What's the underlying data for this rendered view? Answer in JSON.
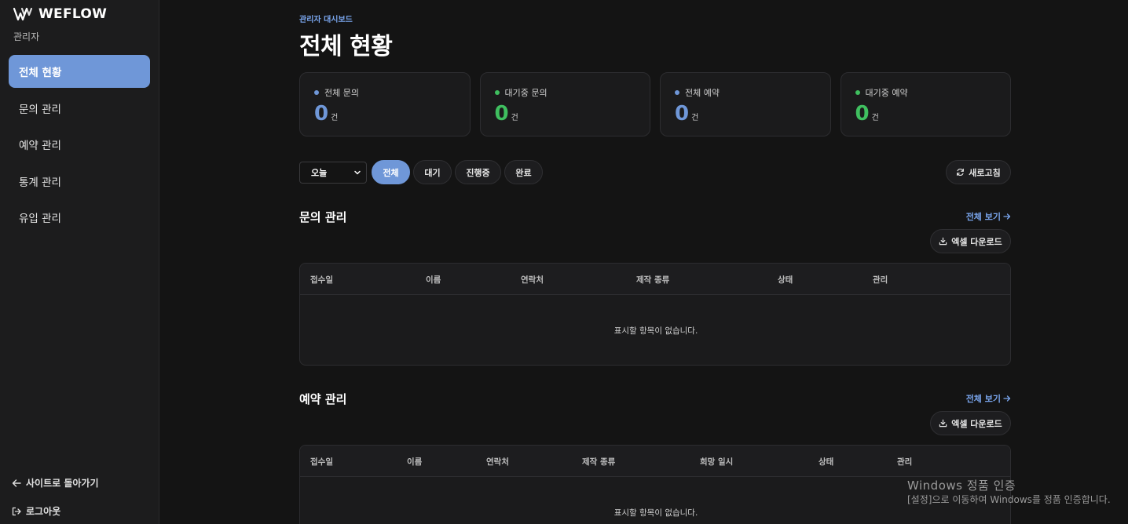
{
  "brand": {
    "name": "WEFLOW",
    "role": "관리자"
  },
  "sidebar": {
    "items": [
      {
        "label": "전체 현황",
        "active": true
      },
      {
        "label": "문의 관리",
        "active": false
      },
      {
        "label": "예약 관리",
        "active": false
      },
      {
        "label": "통계 관리",
        "active": false
      },
      {
        "label": "유입 관리",
        "active": false
      }
    ],
    "back_label": "사이트로 돌아가기",
    "logout_label": "로그아웃"
  },
  "header": {
    "eyebrow": "관리자 대시보드",
    "title": "전체 현황"
  },
  "stats": [
    {
      "label": "전체 문의",
      "value": "0",
      "unit": "건",
      "color": "#6f97d8"
    },
    {
      "label": "대기중 문의",
      "value": "0",
      "unit": "건",
      "color": "#3fbf5f"
    },
    {
      "label": "전체 예약",
      "value": "0",
      "unit": "건",
      "color": "#6f97d8"
    },
    {
      "label": "대기중 예약",
      "value": "0",
      "unit": "건",
      "color": "#3fbf5f"
    }
  ],
  "filters": {
    "period_selected": "오늘",
    "status_pills": [
      "전체",
      "대기",
      "진행중",
      "완료"
    ],
    "active_pill": "전체",
    "refresh_label": "새로고침"
  },
  "inquiries": {
    "title": "문의 관리",
    "view_all": "전체 보기",
    "excel_label": "엑셀 다운로드",
    "columns": [
      "접수일",
      "이름",
      "연락처",
      "제작 종류",
      "상태",
      "관리"
    ],
    "empty_text": "표시할 항목이 없습니다."
  },
  "reservations": {
    "title": "예약 관리",
    "view_all": "전체 보기",
    "excel_label": "엑셀 다운로드",
    "columns": [
      "접수일",
      "이름",
      "연락처",
      "제작 종류",
      "희망 일시",
      "상태",
      "관리"
    ],
    "empty_text": "표시할 항목이 없습니다."
  },
  "watermark": {
    "line1": "Windows 정품 인증",
    "line2": "[설정]으로 이동하여 Windows를 정품 인증합니다."
  },
  "colors": {
    "accent": "#6f97d8",
    "link": "#7aa6ee",
    "success": "#3fbf5f",
    "background": "#141414"
  }
}
